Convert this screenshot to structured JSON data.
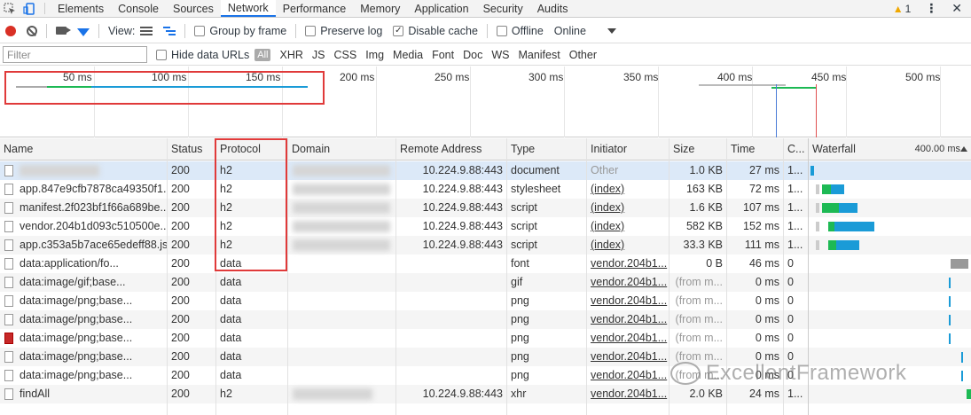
{
  "tabs": [
    "Elements",
    "Console",
    "Sources",
    "Network",
    "Performance",
    "Memory",
    "Application",
    "Security",
    "Audits"
  ],
  "active_tab": "Network",
  "warnings_count": "1",
  "toolbar": {
    "view_label": "View:",
    "group_by_frame": "Group by frame",
    "preserve_log": "Preserve log",
    "disable_cache": "Disable cache",
    "offline": "Offline",
    "throttle": "Online",
    "disable_cache_checked": "✓"
  },
  "filterbar": {
    "placeholder": "Filter",
    "hide_data_urls": "Hide data URLs",
    "all": "All",
    "types": [
      "XHR",
      "JS",
      "CSS",
      "Img",
      "Media",
      "Font",
      "Doc",
      "WS",
      "Manifest",
      "Other"
    ]
  },
  "overview": {
    "ticks": [
      "50 ms",
      "100 ms",
      "150 ms",
      "200 ms",
      "250 ms",
      "300 ms",
      "350 ms",
      "400 ms",
      "450 ms",
      "500 ms"
    ]
  },
  "columns": [
    "Name",
    "Status",
    "Protocol",
    "Domain",
    "Remote Address",
    "Type",
    "Initiator",
    "Size",
    "Time",
    "C...",
    "Waterfall",
    "400.00 ms"
  ],
  "rows": [
    {
      "name": "",
      "status": "200",
      "protocol": "h2",
      "remote": "10.224.9.88:443",
      "type": "document",
      "initiator": "Other",
      "size": "1.0 KB",
      "time": "27 ms",
      "c": "1..."
    },
    {
      "name": "app.847e9cfb7878ca49350f1...",
      "status": "200",
      "protocol": "h2",
      "remote": "10.224.9.88:443",
      "type": "stylesheet",
      "initiator": "(index)",
      "size": "163 KB",
      "time": "72 ms",
      "c": "1..."
    },
    {
      "name": "manifest.2f023bf1f66a689be...",
      "status": "200",
      "protocol": "h2",
      "remote": "10.224.9.88:443",
      "type": "script",
      "initiator": "(index)",
      "size": "1.6 KB",
      "time": "107 ms",
      "c": "1..."
    },
    {
      "name": "vendor.204b1d093c510500e...",
      "status": "200",
      "protocol": "h2",
      "remote": "10.224.9.88:443",
      "type": "script",
      "initiator": "(index)",
      "size": "582 KB",
      "time": "152 ms",
      "c": "1..."
    },
    {
      "name": "app.c353a5b7ace65edeff88.js",
      "status": "200",
      "protocol": "h2",
      "remote": "10.224.9.88:443",
      "type": "script",
      "initiator": "(index)",
      "size": "33.3 KB",
      "time": "111 ms",
      "c": "1..."
    },
    {
      "name": "data:application/fo...",
      "status": "200",
      "protocol": "data",
      "remote": "",
      "type": "font",
      "initiator": "vendor.204b1...",
      "size": "0 B",
      "time": "46 ms",
      "c": "0"
    },
    {
      "name": "data:image/gif;base...",
      "status": "200",
      "protocol": "data",
      "remote": "",
      "type": "gif",
      "initiator": "vendor.204b1...",
      "size": "(from m...",
      "time": "0 ms",
      "c": "0"
    },
    {
      "name": "data:image/png;base...",
      "status": "200",
      "protocol": "data",
      "remote": "",
      "type": "png",
      "initiator": "vendor.204b1...",
      "size": "(from m...",
      "time": "0 ms",
      "c": "0"
    },
    {
      "name": "data:image/png;base...",
      "status": "200",
      "protocol": "data",
      "remote": "",
      "type": "png",
      "initiator": "vendor.204b1...",
      "size": "(from m...",
      "time": "0 ms",
      "c": "0"
    },
    {
      "name": "data:image/png;base...",
      "status": "200",
      "protocol": "data",
      "remote": "",
      "type": "png",
      "initiator": "vendor.204b1...",
      "size": "(from m...",
      "time": "0 ms",
      "c": "0"
    },
    {
      "name": "data:image/png;base...",
      "status": "200",
      "protocol": "data",
      "remote": "",
      "type": "png",
      "initiator": "vendor.204b1...",
      "size": "(from m...",
      "time": "0 ms",
      "c": "0"
    },
    {
      "name": "data:image/png;base...",
      "status": "200",
      "protocol": "data",
      "remote": "",
      "type": "png",
      "initiator": "vendor.204b1...",
      "size": "(from m...",
      "time": "0 ms",
      "c": "0"
    },
    {
      "name": "findAll",
      "status": "200",
      "protocol": "h2",
      "remote": "10.224.9.88:443",
      "type": "xhr",
      "initiator": "vendor.204b1...",
      "size": "2.0 KB",
      "time": "24 ms",
      "c": "1..."
    }
  ],
  "watermark": "ExcellentFramework",
  "colors": {
    "accent": "#1a73e8",
    "highlight": "#e03a3a",
    "record": "#d93025"
  }
}
